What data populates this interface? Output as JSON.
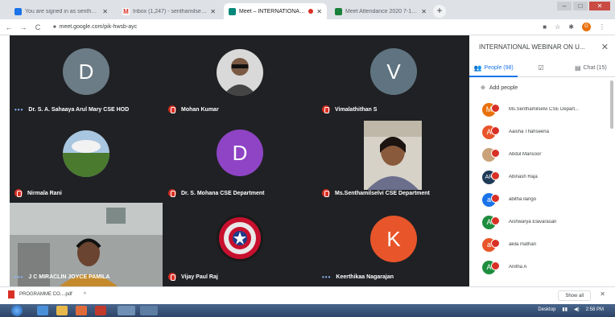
{
  "browser": {
    "tabs": [
      {
        "title": "You are signed in as senthamilse...",
        "favicon_color": "#1a73e8",
        "active": false
      },
      {
        "title": "Inbox (1,247) - senthamilselvi.cse...",
        "favicon_color": "#d93025",
        "active": false,
        "favicon_glyph": "M"
      },
      {
        "title": "Meet – INTERNATIONAL W...",
        "favicon_color": "#00897b",
        "active": true,
        "recording": true
      },
      {
        "title": "Meet Attendance 2020 7-15 (in...",
        "favicon_color": "#188038",
        "active": false
      }
    ],
    "new_tab_icon": "plus-icon",
    "url": "meet.google.com/pik-hwsb-ayc",
    "profile_letter": "G"
  },
  "meet": {
    "tiles": [
      {
        "name": "Dr. S. A. Sahaaya Arul Mary CSE HOD",
        "type": "avatar",
        "letter": "D",
        "color": "#6b7c86",
        "indicator": "dots"
      },
      {
        "name": "Mohan Kumar",
        "type": "photo",
        "indicator": "mute"
      },
      {
        "name": "Vimalathithan S",
        "type": "avatar",
        "letter": "V",
        "color": "#5f7480",
        "indicator": "mute"
      },
      {
        "name": "Nirmala Rani",
        "type": "photo",
        "indicator": "mute"
      },
      {
        "name": "Dr. S. Mohana CSE Department",
        "type": "avatar",
        "letter": "D",
        "color": "#8e44c4",
        "indicator": "mute"
      },
      {
        "name": "Ms.Senthamilselvi CSE Department",
        "type": "video",
        "indicator": "mute"
      },
      {
        "name": "J C MIRACLIN JOYCE PAMILA",
        "type": "video",
        "indicator": "dots"
      },
      {
        "name": "Vijay Paul Raj",
        "type": "photo",
        "indicator": "mute"
      },
      {
        "name": "Keerthikaa Nagarajan",
        "type": "avatar",
        "letter": "K",
        "color": "#e8552a",
        "indicator": "dots"
      }
    ]
  },
  "sidebar": {
    "title": "INTERNATIONAL WEBINAR ON U...",
    "tabs": [
      {
        "label": "People (98)",
        "icon": "people-icon",
        "active": true
      },
      {
        "label": "",
        "icon": "checkbox-icon",
        "active": false
      },
      {
        "label": "Chat (15)",
        "icon": "chat-icon",
        "active": false
      }
    ],
    "add_people": "Add people",
    "participants": [
      {
        "name": "Ms.Senthamilselvi CSE Depart...",
        "letter": "M",
        "color": "#e8710a"
      },
      {
        "name": "Aaisha Thahseena",
        "letter": "A",
        "color": "#e8552a"
      },
      {
        "name": "Abdul Mansoor",
        "letter": "",
        "color": "#c9a27a"
      },
      {
        "name": "Abinash Raja",
        "letter": "AR",
        "color": "#1f3b57"
      },
      {
        "name": "abitha ilango",
        "letter": "a",
        "color": "#1a73e8"
      },
      {
        "name": "Aishwarya Elavarasan",
        "letter": "A",
        "color": "#1e8e3e"
      },
      {
        "name": "akila mathan",
        "letter": "a",
        "color": "#e8552a"
      },
      {
        "name": "Anitha A",
        "letter": "A",
        "color": "#1e8e3e"
      }
    ]
  },
  "downloads": {
    "file": "PROGRAMME CO....pdf",
    "show_all": "Show all"
  },
  "taskbar": {
    "desktop_label": "Desktop",
    "time": "2:58 PM"
  }
}
